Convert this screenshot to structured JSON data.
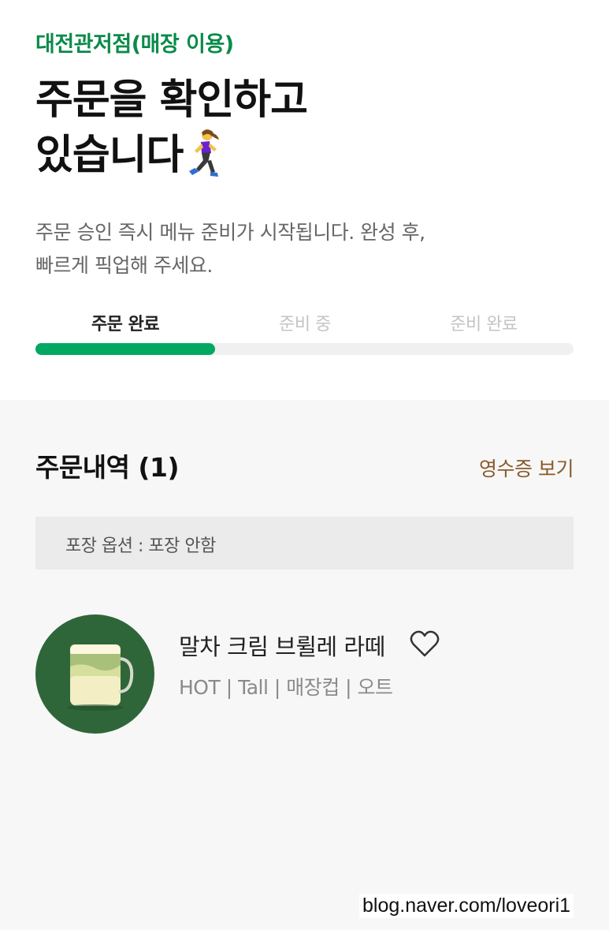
{
  "store": {
    "name": "대전관저점(매장 이용)"
  },
  "header": {
    "title_line1": "주문을 확인하고",
    "title_line2": "있습니다",
    "title_emoji": "woman-running-icon"
  },
  "description": {
    "line1": "주문 승인 즉시 메뉴 준비가 시작됩니다. 완성 후,",
    "line2": "빠르게 픽업해 주세요."
  },
  "progress": {
    "steps": [
      {
        "label": "주문 완료",
        "active": true
      },
      {
        "label": "준비 중",
        "active": false
      },
      {
        "label": "준비 완료",
        "active": false
      }
    ],
    "completed_fraction": 0.3333,
    "color": "#00a862"
  },
  "order": {
    "title": "주문내역 (1)",
    "receipt_label": "영수증 보기",
    "packaging_option": "포장 옵션 : 포장 안함",
    "items": [
      {
        "name": "말차 크림 브륄레 라떼",
        "options": "HOT | Tall | 매장컵 | 오트",
        "image": "matcha-latte-image",
        "favorite_icon": "heart-outline-icon"
      }
    ]
  },
  "colors": {
    "brand_green": "#0b8a4a",
    "accent_brown": "#8a5a2b"
  },
  "watermark": "blog.naver.com/loveori1"
}
